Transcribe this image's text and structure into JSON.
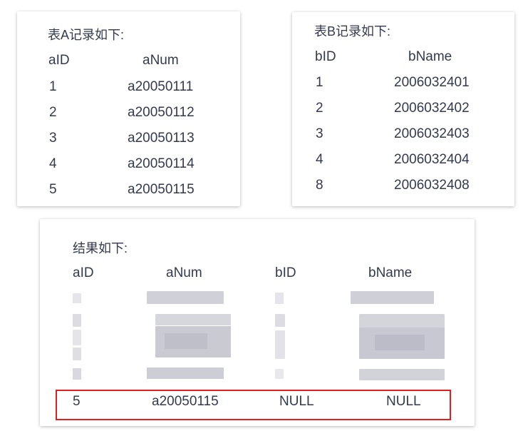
{
  "table_a": {
    "title": "表A记录如下:",
    "headers": [
      "aID",
      "aNum"
    ],
    "rows": [
      [
        "1",
        "a20050111"
      ],
      [
        "2",
        "a20050112"
      ],
      [
        "3",
        "a20050113"
      ],
      [
        "4",
        "a20050114"
      ],
      [
        "5",
        "a20050115"
      ]
    ]
  },
  "table_b": {
    "title": "表B记录如下:",
    "headers": [
      "bID",
      "bName"
    ],
    "rows": [
      [
        "1",
        "2006032401"
      ],
      [
        "2",
        "2006032402"
      ],
      [
        "3",
        "2006032403"
      ],
      [
        "4",
        "2006032404"
      ],
      [
        "8",
        "2006032408"
      ]
    ]
  },
  "result": {
    "title": "结果如下:",
    "headers": [
      "aID",
      "aNum",
      "bID",
      "bName"
    ],
    "highlighted_row": [
      "5",
      "a20050115",
      "NULL",
      "NULL"
    ],
    "highlight_color": "#e02020"
  }
}
